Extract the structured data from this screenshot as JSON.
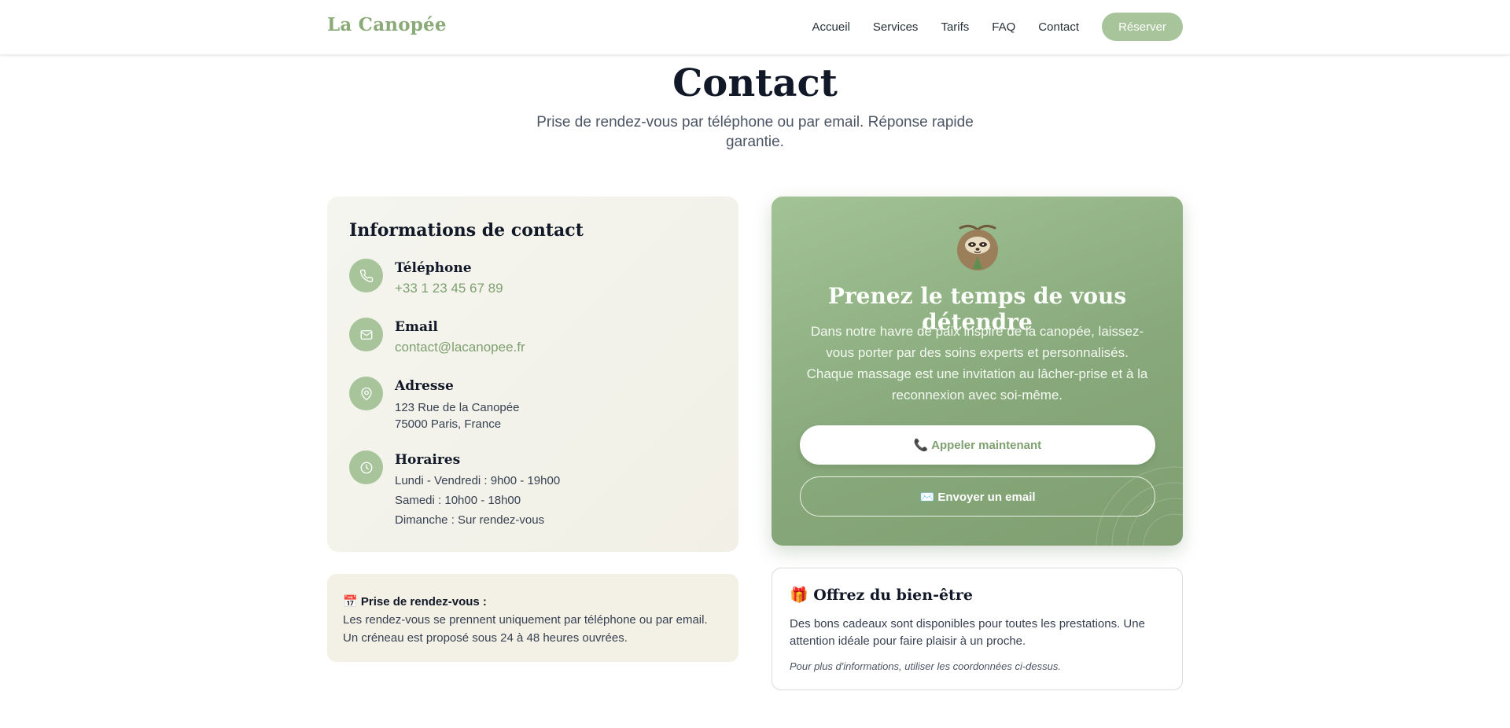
{
  "header": {
    "logo": "La Canopée",
    "nav": [
      "Accueil",
      "Services",
      "Tarifs",
      "FAQ",
      "Contact"
    ],
    "reserve_label": "Réserver"
  },
  "hero": {
    "title": "Contact",
    "subtitle": "Prise de rendez-vous par téléphone ou par email. Réponse rapide garantie."
  },
  "contact_info": {
    "title": "Informations de contact",
    "phone": {
      "icon": "phone-icon",
      "label": "Téléphone",
      "value": "+33 1 23 45 67 89"
    },
    "email": {
      "icon": "mail-icon",
      "label": "Email",
      "value": "contact@lacanopee.fr"
    },
    "address": {
      "icon": "map-pin-icon",
      "label": "Adresse",
      "line1": "123 Rue de la Canopée",
      "line2": "75000 Paris, France"
    },
    "hours": {
      "icon": "clock-icon",
      "label": "Horaires",
      "lines": [
        "Lundi - Vendredi : 9h00 - 19h00",
        "Samedi : 10h00 - 18h00",
        "Dimanche : Sur rendez-vous"
      ]
    }
  },
  "appointment_note": {
    "emoji": "📅",
    "title": "Prise de rendez-vous :",
    "text": "Les rendez-vous se prennent uniquement par téléphone ou par email. Un créneau est proposé sous 24 à 48 heures ouvrées."
  },
  "relax_card": {
    "mascot": "sloth-icon",
    "title": "Prenez le temps de vous détendre",
    "text": "Dans notre havre de paix inspiré de la canopée, laissez-vous porter par des soins experts et personnalisés. Chaque massage est une invitation au lâcher-prise et à la reconnexion avec soi-même.",
    "call_label": "📞 Appeler maintenant",
    "email_label": "✉️ Envoyer un email"
  },
  "gift": {
    "emoji": "🎁",
    "title": "Offrez du bien-être",
    "text": "Des bons cadeaux sont disponibles pour toutes les prestations. Une attention idéale pour faire plaisir à un proche.",
    "note": "Pour plus d'informations, utiliser les coordonnées ci-dessus."
  },
  "colors": {
    "accent": "#a7c49a",
    "accent_dark": "#7fa070",
    "card_beige": "#f3f0e5"
  }
}
